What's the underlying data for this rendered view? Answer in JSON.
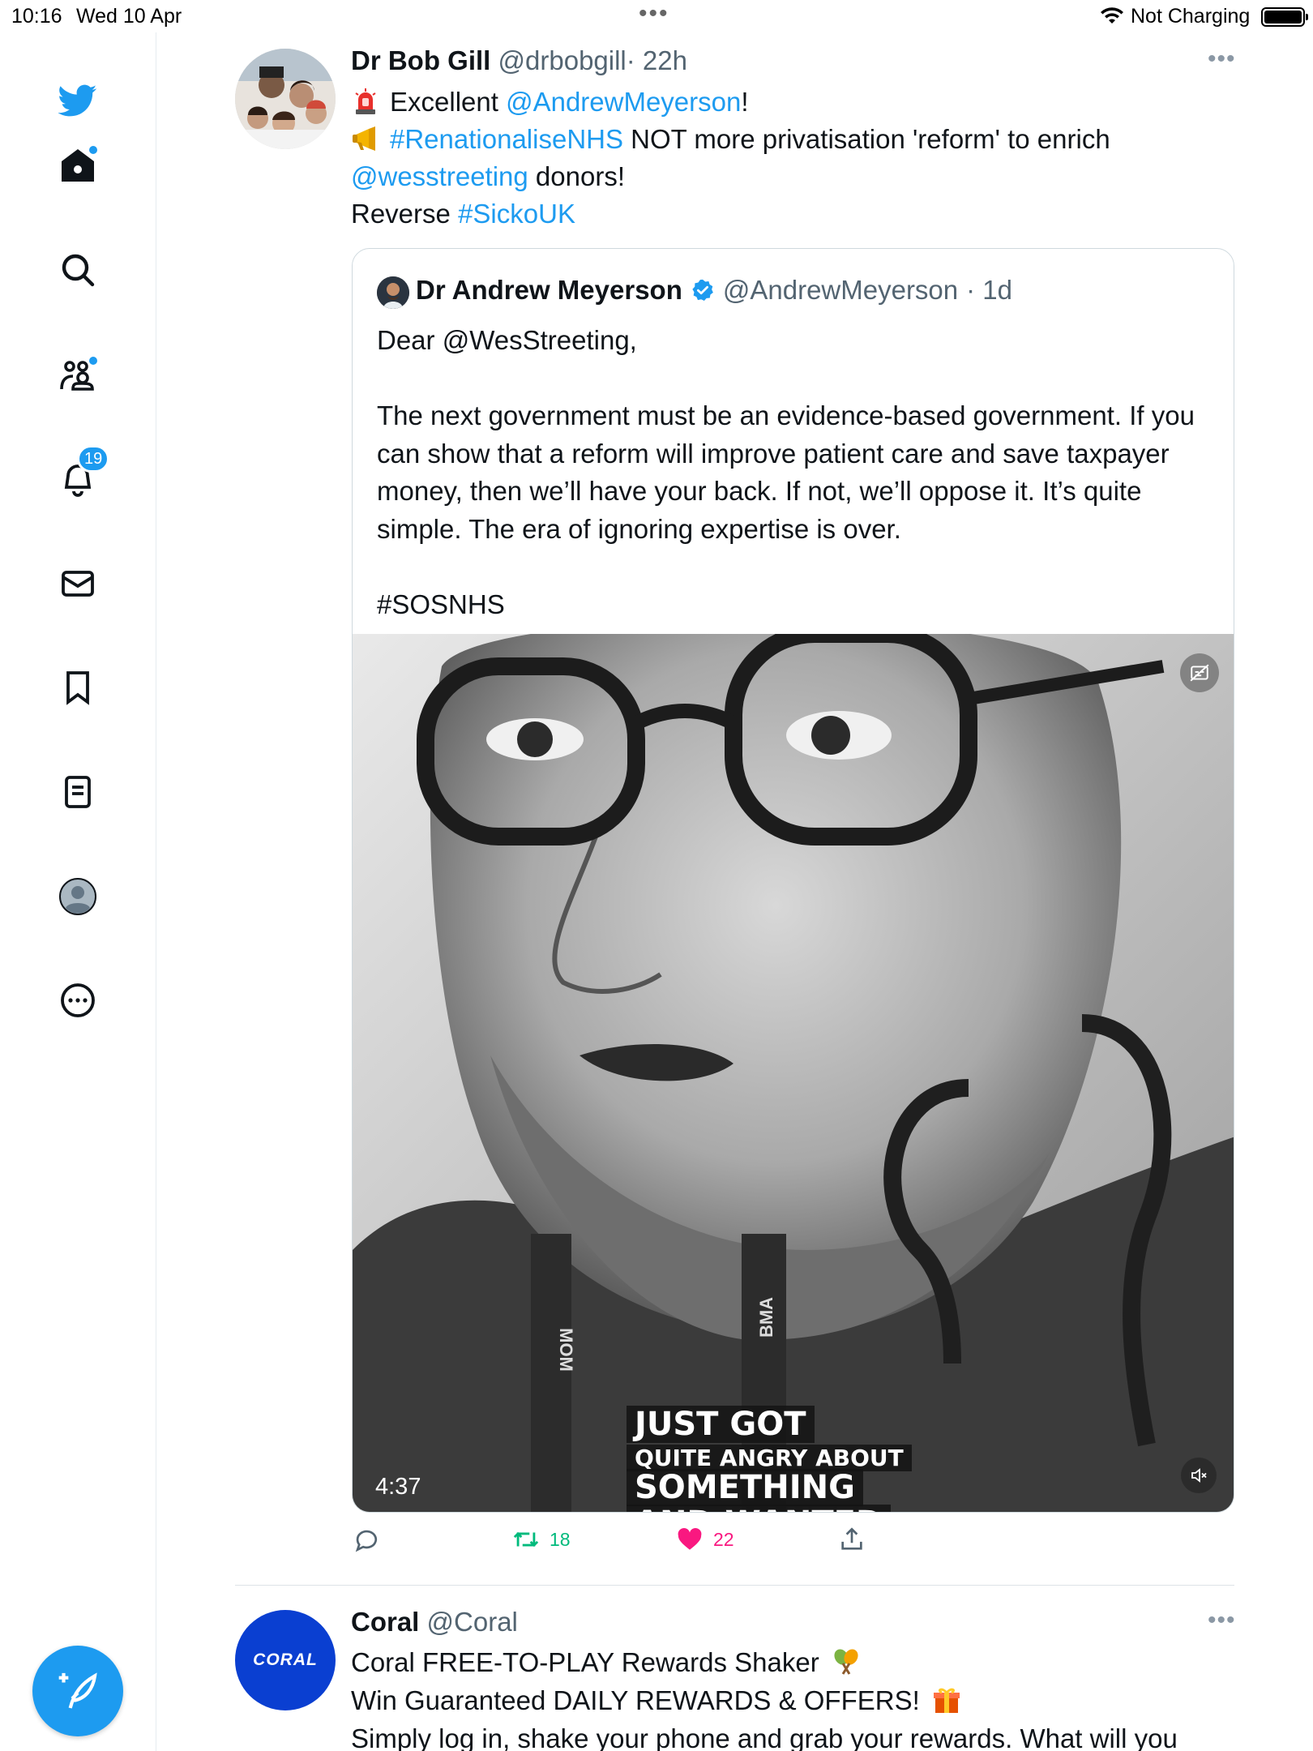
{
  "status_bar": {
    "time": "10:16",
    "date": "Wed 10 Apr",
    "charging": "Not Charging"
  },
  "sidebar": {
    "notifications_count": "19",
    "items": [
      "twitter-logo",
      "home",
      "explore",
      "communities",
      "notifications",
      "messages",
      "bookmarks",
      "lists",
      "profile",
      "more"
    ]
  },
  "tweet": {
    "author_name": "Dr Bob Gill",
    "author_handle": "@drbobgill",
    "time": "· 22h",
    "line1_text": "Excellent ",
    "line1_mention": "@AndrewMeyerson",
    "line1_end": "!",
    "line2_hashtag": "#RenationaliseNHS",
    "line2_text": " NOT more privatisation 'reform' to enrich",
    "line3_mention": "@wesstreeting",
    "line3_text": " donors!",
    "line4_text": "Reverse ",
    "line4_hashtag": "#SickoUK",
    "retweets": "18",
    "likes": "22"
  },
  "quoted_tweet": {
    "author_name": "Dr Andrew Meyerson",
    "author_handle": "@AndrewMeyerson",
    "time": "· 1d",
    "text": "Dear @WesStreeting,\n\nThe next government must be an evidence-based government. If you can show that a reform will improve patient care and save taxpayer money, then we’ll have your back. If not, we’ll oppose it. It’s quite simple. The era of ignoring expertise is over.\n\n#SOSNHS",
    "video": {
      "duration": "4:37",
      "caption_line1": "JUST GOT",
      "caption_line2": "QUITE ANGRY ABOUT",
      "caption_line3": "SOMETHING",
      "caption_line4": "AND WANTED",
      "lanyard_left": "MOM",
      "lanyard_right": "BMA"
    }
  },
  "next_tweet": {
    "author_name": "Coral",
    "author_handle": "@Coral",
    "avatar_text": "CORAL",
    "line1": "Coral FREE-TO-PLAY Rewards Shaker",
    "line2": "Win Guaranteed DAILY REWARDS & OFFERS!",
    "line3": "Simply log in, shake your phone and grab your rewards. What will you"
  },
  "colors": {
    "accent": "#1d9bf0",
    "like": "#f91880",
    "retweet": "#00ba7c",
    "coral_blue": "#0a3fd1"
  }
}
